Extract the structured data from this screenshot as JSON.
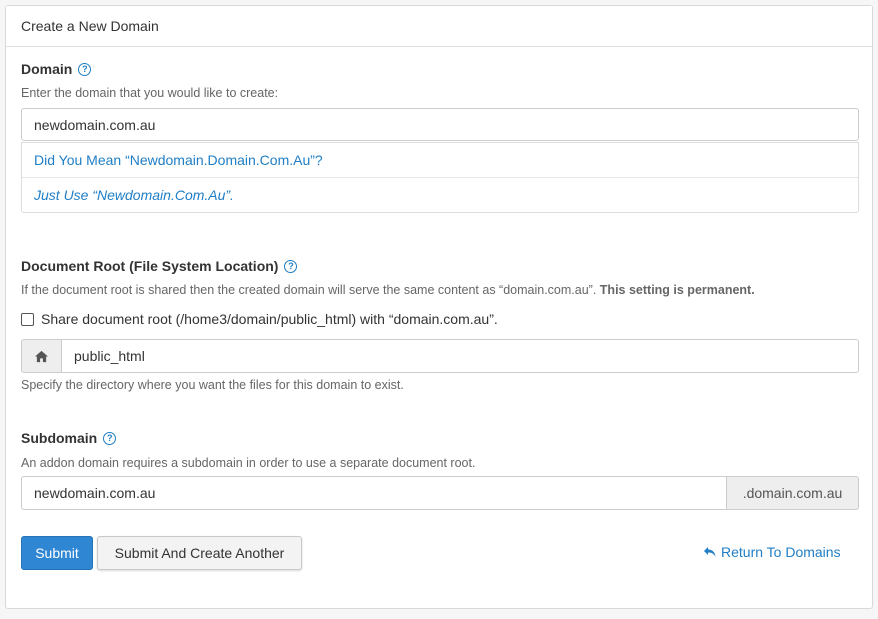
{
  "panel": {
    "title": "Create a New Domain"
  },
  "domain": {
    "label": "Domain",
    "help_icon": "?",
    "hint": "Enter the domain that you would like to create:",
    "value": "newdomain.com.au",
    "suggestions": [
      "Did You Mean “Newdomain.Domain.Com.Au”?",
      "Just Use “Newdomain.Com.Au”."
    ]
  },
  "docroot": {
    "label": "Document Root (File System Location)",
    "help_icon": "?",
    "hint_prefix": "If the document root is shared then the created domain will serve the same content as “domain.com.au”.",
    "hint_bold": "This setting is permanent.",
    "checkbox_label": "Share document root (/home3/domain/public_html) with “domain.com.au”.",
    "checkbox_checked": false,
    "home_icon": "home-icon",
    "value": "public_html",
    "hint2": "Specify the directory where you want the files for this domain to exist."
  },
  "subdomain": {
    "label": "Subdomain",
    "help_icon": "?",
    "hint": "An addon domain requires a subdomain in order to use a separate document root.",
    "value": "newdomain.com.au",
    "suffix": ".domain.com.au"
  },
  "actions": {
    "submit": "Submit",
    "submit_another": "Submit And Create Another",
    "return": "Return To Domains",
    "return_icon": "undo-arrow-icon"
  },
  "colors": {
    "accent": "#2f86d3",
    "link": "#1f7ec5"
  }
}
